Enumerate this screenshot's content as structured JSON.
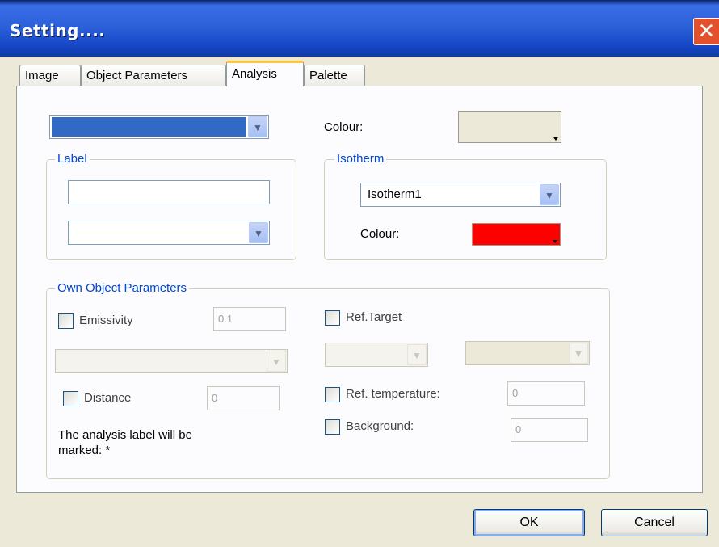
{
  "window": {
    "title": "Setting...."
  },
  "tabs": [
    {
      "label": "Image"
    },
    {
      "label": "Object Parameters"
    },
    {
      "label": "Analysis"
    },
    {
      "label": "Palette"
    }
  ],
  "analysis": {
    "object_select": {
      "value": ""
    },
    "colour_label": "Colour:",
    "label_group": {
      "legend": "Label",
      "text_value": "",
      "select_value": ""
    },
    "isotherm_group": {
      "legend": "Isotherm",
      "select_value": "Isotherm1",
      "colour_label": "Colour:",
      "colour": "#ff0000"
    },
    "own_params": {
      "legend": "Own Object Parameters",
      "emissivity_label": "Emissivity",
      "emissivity_value": "0.1",
      "ref_target_label": "Ref.Target",
      "distance_label": "Distance",
      "distance_value": "0",
      "ref_temperature_label": "Ref. temperature:",
      "ref_temperature_value": "0",
      "background_label": "Background:",
      "background_value": "0",
      "note_line1": "The analysis label will be",
      "note_line2": "marked: *"
    }
  },
  "buttons": {
    "ok": "OK",
    "cancel": "Cancel"
  },
  "colors": {
    "selection_blue": "#316ac5",
    "legend_blue": "#0046d5",
    "isotherm_colour": "#ff0000"
  }
}
